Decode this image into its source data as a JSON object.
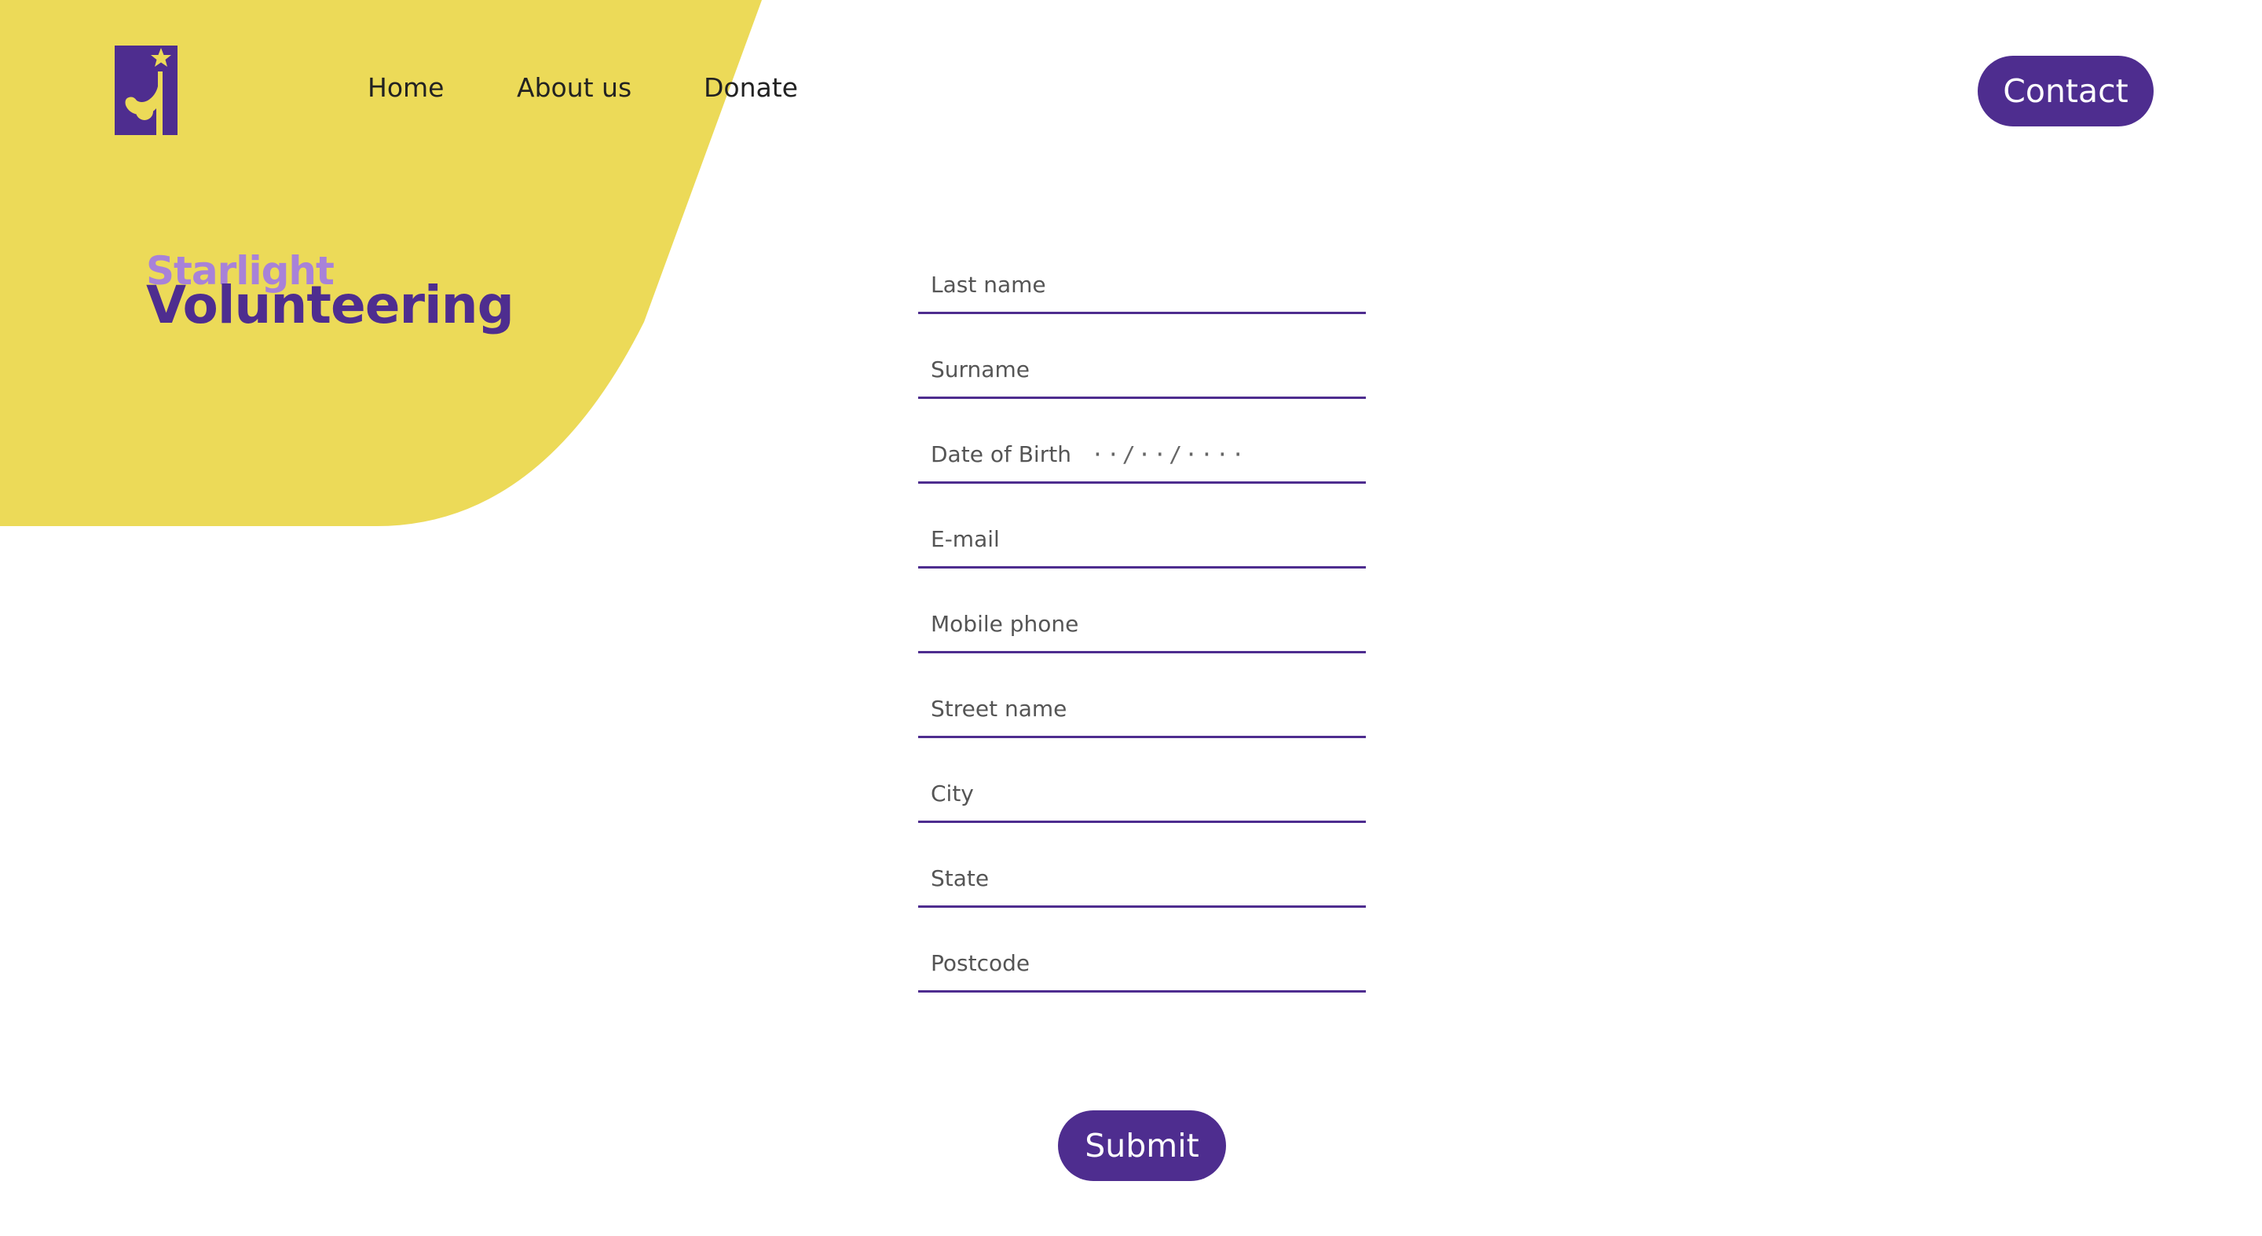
{
  "nav": {
    "home": "Home",
    "about": "About us",
    "donate": "Donate",
    "contact": "Contact"
  },
  "brand": {
    "line1": "Starlight",
    "line2": "Volunteering"
  },
  "form": {
    "fields": [
      {
        "label": "Last name"
      },
      {
        "label": "Surname"
      },
      {
        "label": "Date of Birth",
        "mask": "··/··/····"
      },
      {
        "label": "E-mail"
      },
      {
        "label": "Mobile phone"
      },
      {
        "label": "Street name"
      },
      {
        "label": "City"
      },
      {
        "label": "State"
      },
      {
        "label": "Postcode"
      }
    ],
    "submit": "Submit"
  },
  "colors": {
    "accent": "#4e2d8f",
    "accent_light": "#a882d8",
    "background_shape": "#ecda58",
    "page_background": "#ffffff"
  },
  "icons": {
    "logo": "star-reaching-figure-logo"
  }
}
